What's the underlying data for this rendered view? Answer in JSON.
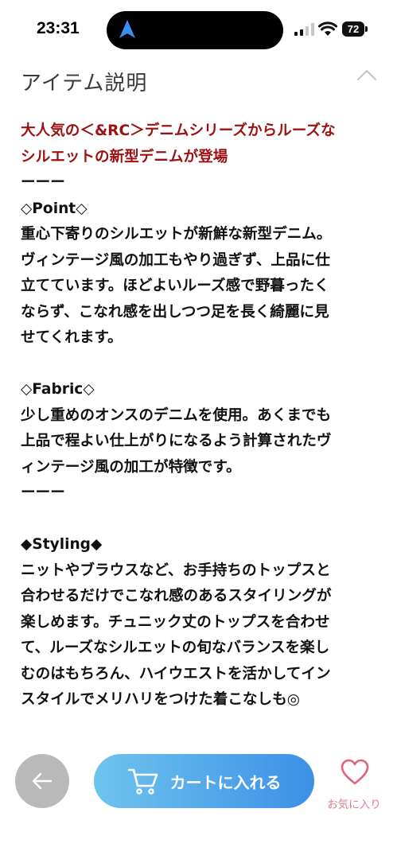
{
  "status_bar": {
    "time": "23:31",
    "battery": "72"
  },
  "section": {
    "title": "アイテム説明"
  },
  "description": {
    "lines": [
      {
        "text": "大人気の＜&RC＞デニムシリーズからルーズな",
        "style": "red"
      },
      {
        "text": "シルエットの新型デニムが登場",
        "style": "red"
      },
      {
        "text": "ーーー",
        "style": "normal"
      },
      {
        "text": "◇Point◇",
        "style": "normal"
      },
      {
        "text": "重心下寄りのシルエットが新鮮な新型デニム。",
        "style": "normal"
      },
      {
        "text": "ヴィンテージ風の加工もやり過ぎず、上品に仕",
        "style": "normal"
      },
      {
        "text": "立てています。ほどよいルーズ感で野暮ったく",
        "style": "normal"
      },
      {
        "text": "ならず、こなれ感を出しつつ足を長く綺麗に見",
        "style": "normal"
      },
      {
        "text": "せてくれます。",
        "style": "normal"
      },
      {
        "text": "",
        "style": "gap"
      },
      {
        "text": "◇Fabric◇",
        "style": "normal"
      },
      {
        "text": "少し重めのオンスのデニムを使用。あくまでも",
        "style": "normal"
      },
      {
        "text": "上品で程よい仕上がりになるよう計算されたヴ",
        "style": "normal"
      },
      {
        "text": "ィンテージ風の加工が特徴です。",
        "style": "normal"
      },
      {
        "text": "ーーー",
        "style": "normal"
      },
      {
        "text": "",
        "style": "gap"
      },
      {
        "text": "◆Styling◆",
        "style": "normal"
      },
      {
        "text": "ニットやブラウスなど、お手持ちのトップスと",
        "style": "normal"
      },
      {
        "text": "合わせるだけでこなれ感のあるスタイリングが",
        "style": "normal"
      },
      {
        "text": "楽しめます。チュニック丈のトップスを合わせ",
        "style": "normal"
      },
      {
        "text": "て、ルーズなシルエットの旬なバランスを楽し",
        "style": "normal"
      },
      {
        "text": "むのはもちろん、ハイウエストを活かしてイン",
        "style": "normal"
      },
      {
        "text": "スタイルでメリハリをつけた着こなしも◎",
        "style": "normal"
      }
    ]
  },
  "bottom_bar": {
    "back_icon": "arrow-left-icon",
    "cart_label": "カートに入れる",
    "cart_icon": "cart-icon",
    "favorite_label": "お気に入り",
    "favorite_icon": "heart-outline-icon"
  },
  "colors": {
    "highlight_red": "#9b1010",
    "cart_gradient_start": "#6fc4ee",
    "cart_gradient_end": "#3d8fe6",
    "favorite_pink": "#e07b8c",
    "back_button_gray": "#b9b9b9"
  }
}
